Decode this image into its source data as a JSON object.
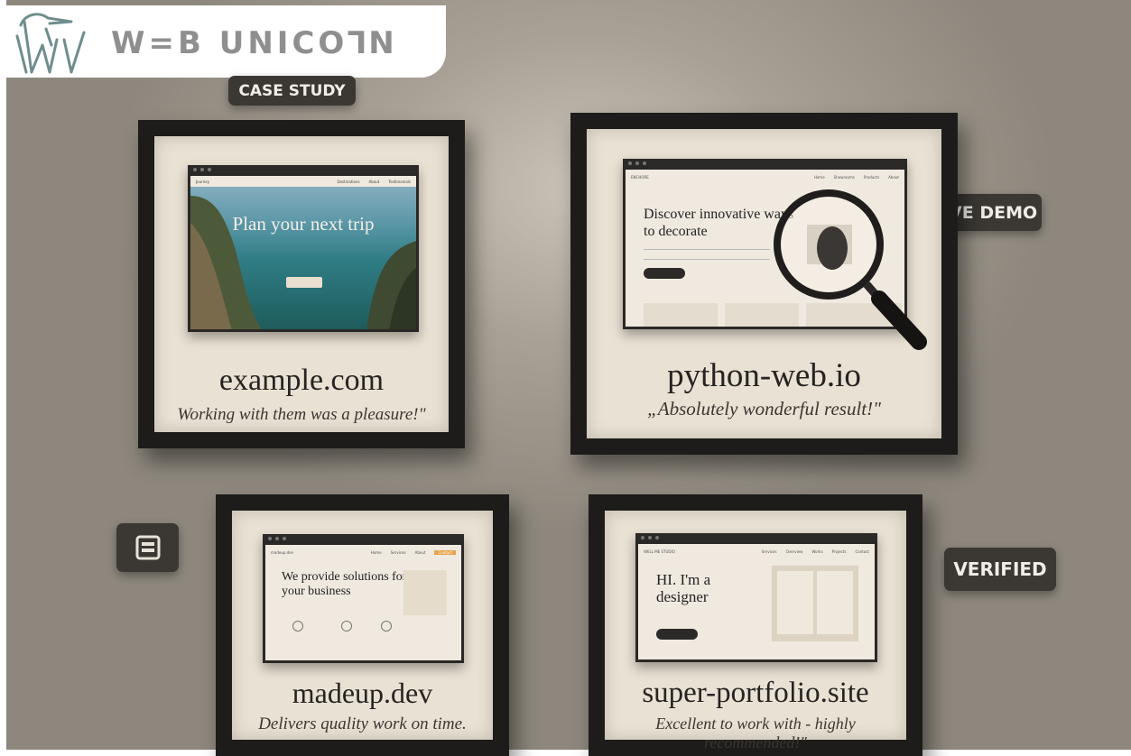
{
  "brand": {
    "logo_text": "W=B UNICO⅂N",
    "accent": "#8f8f8f"
  },
  "badges": {
    "case_study": "CASE STUDY",
    "live_demo": "LIVE DEMO",
    "verified": "VERIFIED"
  },
  "frames": [
    {
      "domain": "example.com",
      "quote": "Working with them was a pleasure!\"",
      "site_headline": "Plan your next trip"
    },
    {
      "domain": "python-web.io",
      "quote": "„Absolutely wonderful result!\"",
      "site_headline": "Discover innovative ways to decorate"
    },
    {
      "domain": "madeup.dev",
      "quote": "Delivers quality work on time.",
      "site_headline": "We provide solutions for your business"
    },
    {
      "domain": "super-portfolio.site",
      "quote": "Excellent to work with - highly recommended!\"",
      "site_headline": "HI. I'm a designer"
    }
  ]
}
